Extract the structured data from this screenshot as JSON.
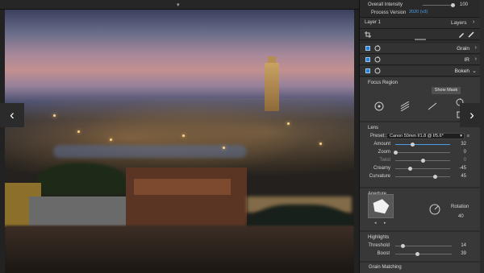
{
  "canvas": {
    "prev_icon": "chevron-left-icon",
    "next_icon": "chevron-right-icon",
    "collapse_icon": "chevron-down-icon"
  },
  "panel": {
    "overall_intensity": {
      "label": "Overall Intensity",
      "value": "100",
      "level": 1.0
    },
    "process_version": {
      "label": "Process Version",
      "value": "2020 (v3)"
    },
    "layer": {
      "name": "Layer 1",
      "menu_label": "Layers"
    },
    "filters": [
      {
        "name": "Grain",
        "enabled": true
      },
      {
        "name": "IR",
        "enabled": true
      },
      {
        "name": "Bokeh",
        "enabled": true
      }
    ],
    "focus_region": {
      "title": "Focus Region",
      "show_mask_label": "Show Mask"
    },
    "lens": {
      "title": "Lens",
      "preset_label": "Preset:",
      "preset_value": "Canon 50mm f/1.8 @ f/5.6*",
      "sliders": [
        {
          "label": "Amount",
          "value": "32",
          "level": 0.32,
          "active": true
        },
        {
          "label": "Zoom",
          "value": "0",
          "level": 0.0,
          "active": false
        },
        {
          "label": "Twist",
          "value": "0",
          "level": 0.5,
          "active": false,
          "disabled": true
        },
        {
          "label": "Creamy",
          "value": "-45",
          "level": 0.275,
          "active": false
        },
        {
          "label": "Curvature",
          "value": "45",
          "level": 0.725,
          "active": false
        }
      ]
    },
    "aperture": {
      "title": "Aperture",
      "rotation_label": "Rotation",
      "rotation_value": "40"
    },
    "highlights": {
      "title": "Highlights",
      "sliders": [
        {
          "label": "Threshold",
          "value": "14",
          "level": 0.14
        },
        {
          "label": "Boost",
          "value": "39",
          "level": 0.39
        }
      ]
    },
    "grain_matching": {
      "title": "Grain Matching"
    }
  },
  "colors": {
    "accent": "#4a9ee8",
    "panel_bg": "#2c2c2c",
    "section_bg": "#383838"
  }
}
